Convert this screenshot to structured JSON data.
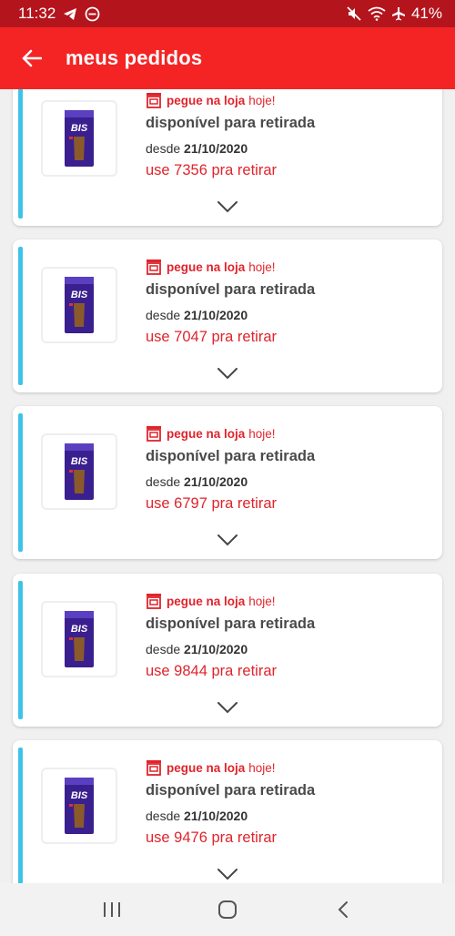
{
  "status_bar": {
    "time": "11:32",
    "battery": "41%"
  },
  "header": {
    "title": "meus pedidos"
  },
  "orders": [
    {
      "pickup_label": "pegue na loja",
      "today_label": "hoje!",
      "status": "disponível para retirada",
      "since_label": "desde",
      "date": "21/10/2020",
      "code_text": "use 7356 pra retirar"
    },
    {
      "pickup_label": "pegue na loja",
      "today_label": "hoje!",
      "status": "disponível para retirada",
      "since_label": "desde",
      "date": "21/10/2020",
      "code_text": "use 7047 pra retirar"
    },
    {
      "pickup_label": "pegue na loja",
      "today_label": "hoje!",
      "status": "disponível para retirada",
      "since_label": "desde",
      "date": "21/10/2020",
      "code_text": "use 6797 pra retirar"
    },
    {
      "pickup_label": "pegue na loja",
      "today_label": "hoje!",
      "status": "disponível para retirada",
      "since_label": "desde",
      "date": "21/10/2020",
      "code_text": "use 9844 pra retirar"
    },
    {
      "pickup_label": "pegue na loja",
      "today_label": "hoje!",
      "status": "disponível para retirada",
      "since_label": "desde",
      "date": "21/10/2020",
      "code_text": "use 9476 pra retirar"
    }
  ],
  "product_logo_text": "BIS",
  "colors": {
    "status_bar": "#b4141c",
    "app_bar": "#f42424",
    "accent": "#3ec3e8",
    "red_text": "#e0242c"
  }
}
